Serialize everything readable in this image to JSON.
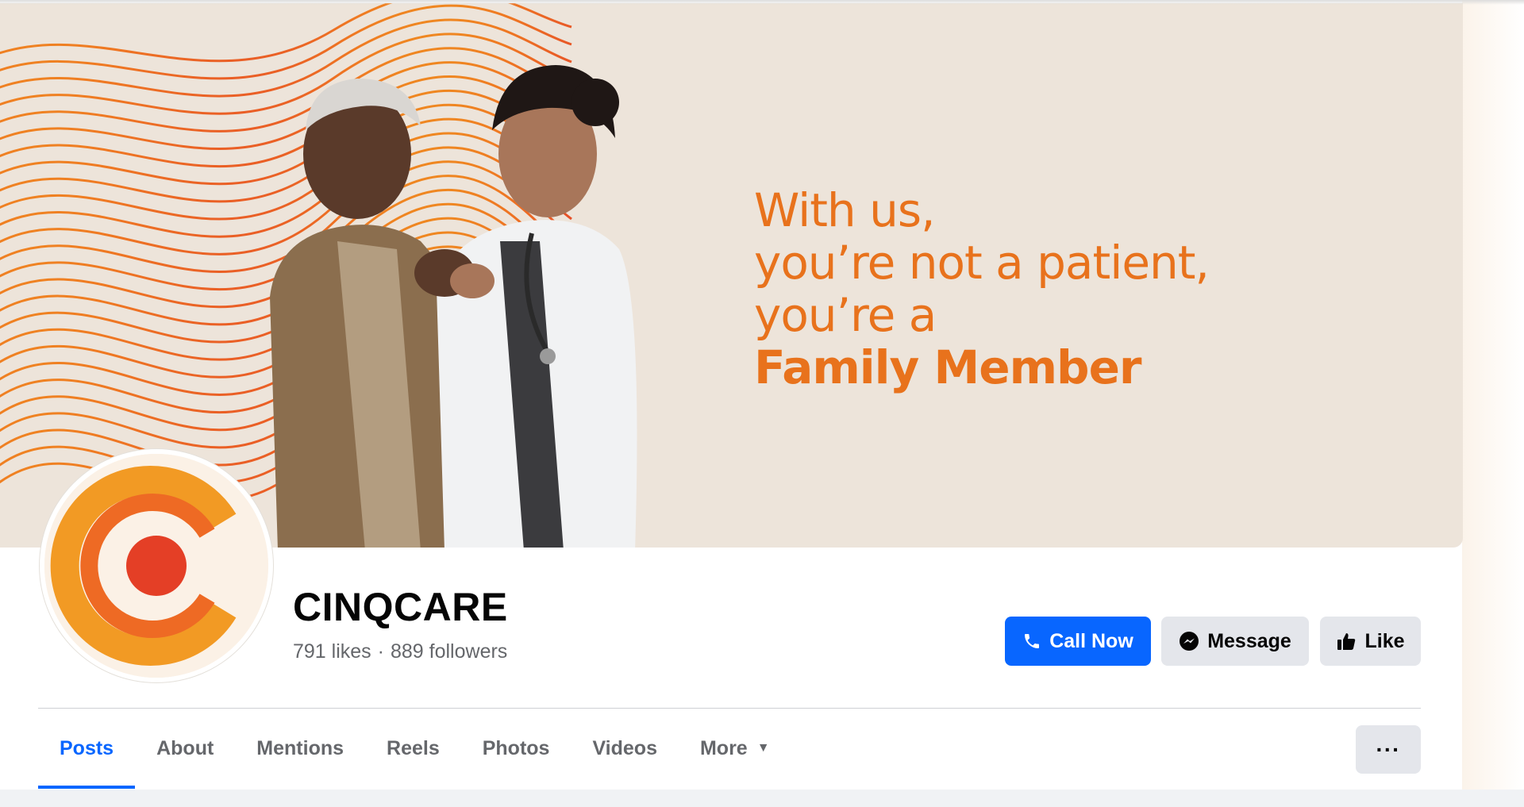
{
  "cover": {
    "headline_lines": [
      "With us,",
      "you’re not a patient,",
      "you’re a"
    ],
    "headline_bold": "Family Member",
    "colors": {
      "background": "#ede4da",
      "accent": "#e8721c"
    }
  },
  "profile": {
    "name": "CINQCARE",
    "likes": "791 likes",
    "separator": "·",
    "followers": "889 followers"
  },
  "actions": {
    "call_label": "Call Now",
    "message_label": "Message",
    "like_label": "Like",
    "icons": [
      "phone-icon",
      "messenger-icon",
      "thumbs-up-icon"
    ]
  },
  "tabs": [
    {
      "label": "Posts",
      "active": true
    },
    {
      "label": "About"
    },
    {
      "label": "Mentions"
    },
    {
      "label": "Reels"
    },
    {
      "label": "Photos"
    },
    {
      "label": "Videos"
    },
    {
      "label": "More"
    }
  ],
  "more_options_label": "···",
  "colors": {
    "brand_blue": "#0866ff",
    "button_gray": "#e4e6eb",
    "secondary_text": "#65676b"
  }
}
